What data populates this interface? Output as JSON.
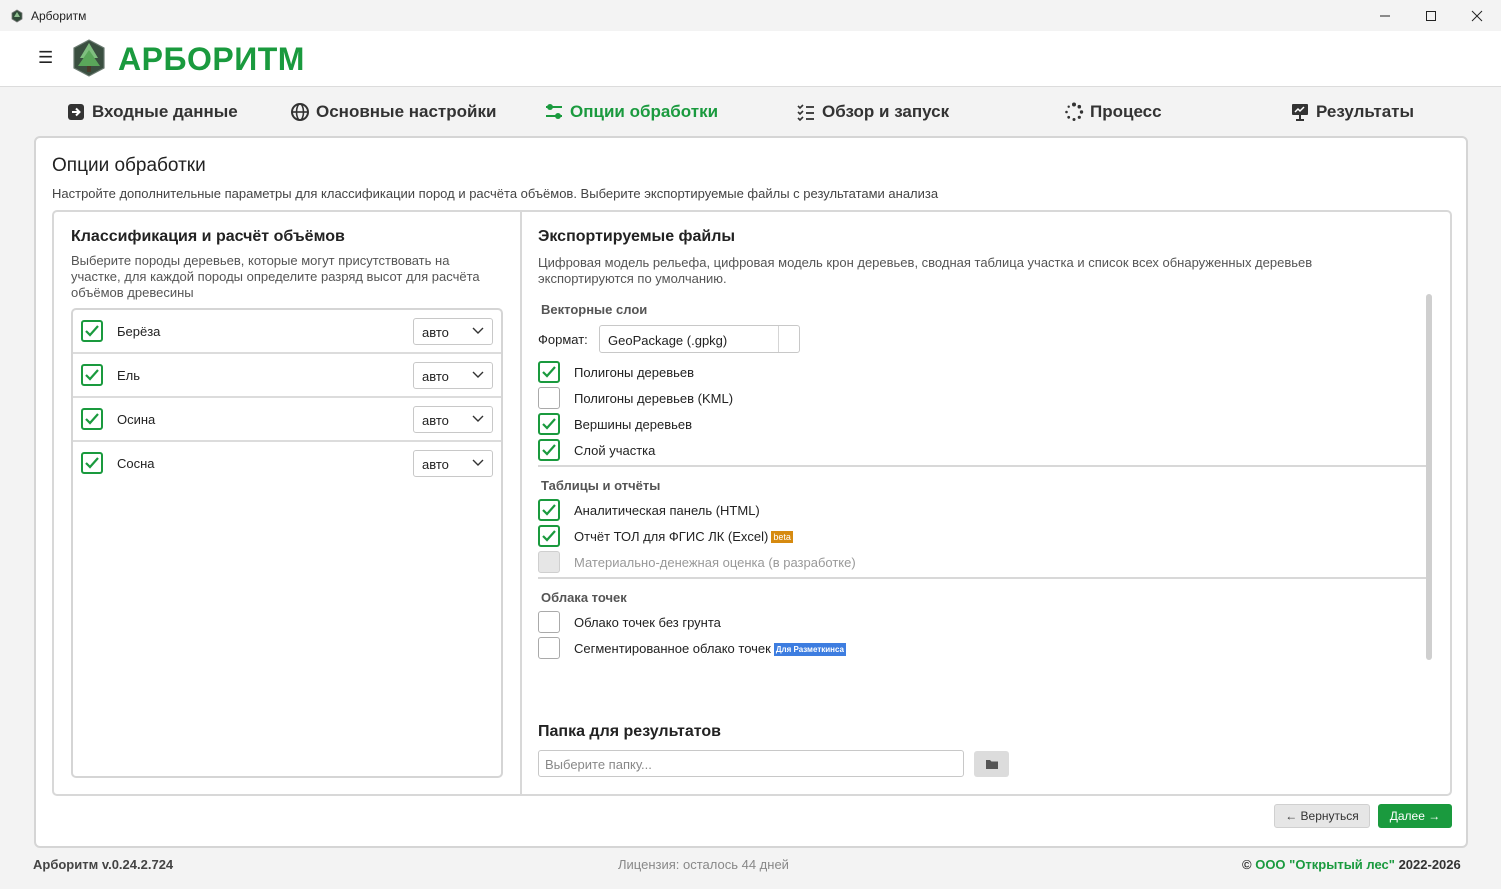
{
  "window": {
    "title": "Арборитм"
  },
  "header": {
    "logo_text": "АРБОРИТМ",
    "menu_icon": "hamburger-icon"
  },
  "steps": [
    {
      "label": "Входные данные",
      "icon": "input-arrow-icon",
      "active": false
    },
    {
      "label": "Основные настройки",
      "icon": "globe-icon",
      "active": false
    },
    {
      "label": "Опции обработки",
      "icon": "sliders-icon",
      "active": true
    },
    {
      "label": "Обзор и запуск",
      "icon": "checklist-icon",
      "active": false
    },
    {
      "label": "Процесс",
      "icon": "spinner-icon",
      "active": false
    },
    {
      "label": "Результаты",
      "icon": "presentation-icon",
      "active": false
    }
  ],
  "page": {
    "title": "Опции обработки",
    "description": "Настройте дополнительные параметры для классификации пород и расчёта объёмов. Выберите экспортируемые файлы с результатами анализа"
  },
  "left_panel": {
    "title": "Классификация и расчёт объёмов",
    "description": "Выберите породы деревьев, которые могут присутствовать на участке, для каждой породы определите разряд высот для расчёта объёмов древесины",
    "species": [
      {
        "name": "Берёза",
        "checked": true,
        "height_class": "авто"
      },
      {
        "name": "Ель",
        "checked": true,
        "height_class": "авто"
      },
      {
        "name": "Осина",
        "checked": true,
        "height_class": "авто"
      },
      {
        "name": "Сосна",
        "checked": true,
        "height_class": "авто"
      }
    ]
  },
  "right_panel": {
    "title": "Экспортируемые файлы",
    "description": "Цифровая модель рельефа, цифровая модель крон деревьев, сводная таблица участка и список всех обнаруженных деревьев экспортируются по умолчанию.",
    "vector_section": "Векторные слои",
    "format_label": "Формат:",
    "format_value": "GeoPackage (.gpkg)",
    "vector_options": [
      {
        "label": "Полигоны деревьев",
        "checked": true
      },
      {
        "label": "Полигоны деревьев (KML)",
        "checked": false
      },
      {
        "label": "Вершины деревьев",
        "checked": true
      },
      {
        "label": "Слой участка",
        "checked": true
      }
    ],
    "tables_section": "Таблицы и отчёты",
    "tables_options": [
      {
        "label": "Аналитическая панель (HTML)",
        "checked": true,
        "disabled": false
      },
      {
        "label": "Отчёт ТОЛ для ФГИС ЛК (Excel)",
        "checked": true,
        "disabled": false,
        "badge": "beta"
      },
      {
        "label": "Материально-денежная оценка (в разработке)",
        "checked": false,
        "disabled": true
      }
    ],
    "points_section": "Облака точек",
    "points_options": [
      {
        "label": "Облако точек без грунта",
        "checked": false
      },
      {
        "label": "Сегментированное облако точек",
        "checked": false,
        "badge": "Для Разметкинса"
      }
    ],
    "folder_title": "Папка для результатов",
    "folder_placeholder": "Выберите папку..."
  },
  "buttons": {
    "back": "← Вернуться",
    "next": "Далее →"
  },
  "footer": {
    "version": "Арборитм v.0.24.2.724",
    "license": "Лицензия: осталось 44 дней",
    "copyright_prefix": "© ",
    "org": "ООО \"Открытый лес\"",
    "years": " 2022-2026"
  },
  "colors": {
    "accent": "#1a9a3e",
    "beta_badge": "#d68a10",
    "info_badge": "#3d7de0"
  }
}
